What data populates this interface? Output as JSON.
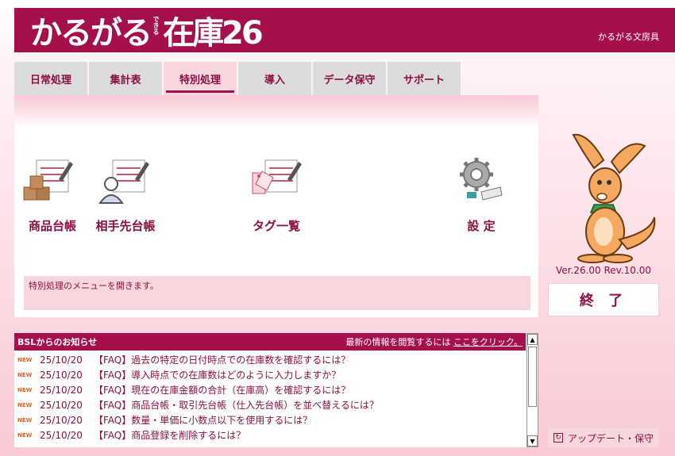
{
  "header": {
    "logo_main": "かるがる",
    "logo_sub": "できる",
    "logo_product": "在庫26",
    "company": "かるがる文房具"
  },
  "tabs": [
    {
      "label": "日常処理"
    },
    {
      "label": "集計表"
    },
    {
      "label": "特別処理",
      "active": true
    },
    {
      "label": "導入"
    },
    {
      "label": "データ保守"
    },
    {
      "label": "サポート"
    }
  ],
  "menu": {
    "items": [
      {
        "label": "商品台帳",
        "icon": "product-ledger-icon"
      },
      {
        "label": "相手先台帳",
        "icon": "partner-ledger-icon"
      },
      {
        "label": "タグ一覧",
        "icon": "tag-list-icon"
      },
      {
        "label": "設 定",
        "icon": "settings-gear-icon"
      }
    ],
    "description": "特別処理のメニューを開きます。"
  },
  "side": {
    "version": "Ver.26.00 Rev.10.00",
    "exit_label": "終 了",
    "update_label": "アップデート・保守"
  },
  "news": {
    "title": "BSLからのお知らせ",
    "link_prefix": "最新の情報を閲覧するには",
    "link_text": "ここをクリック。",
    "badge": "NEW",
    "items": [
      {
        "date": "25/10/20",
        "text": "【FAQ】過去の特定の日付時点での在庫数を確認するには？"
      },
      {
        "date": "25/10/20",
        "text": "【FAQ】導入時点での在庫数はどのように入力しますか？"
      },
      {
        "date": "25/10/20",
        "text": "【FAQ】現在の在庫金額の合計（在庫高）を確認するには？"
      },
      {
        "date": "25/10/20",
        "text": "【FAQ】商品台帳・取引先台帳（仕入先台帳）を並べ替えるには？"
      },
      {
        "date": "25/10/20",
        "text": "【FAQ】数量・単価に小数点以下を使用するには？"
      },
      {
        "date": "25/10/20",
        "text": "【FAQ】商品登録を削除するには？"
      }
    ]
  },
  "colors": {
    "brand": "#a5104c",
    "accent_text": "#8a0f42",
    "pink_light": "#f9d6de"
  }
}
